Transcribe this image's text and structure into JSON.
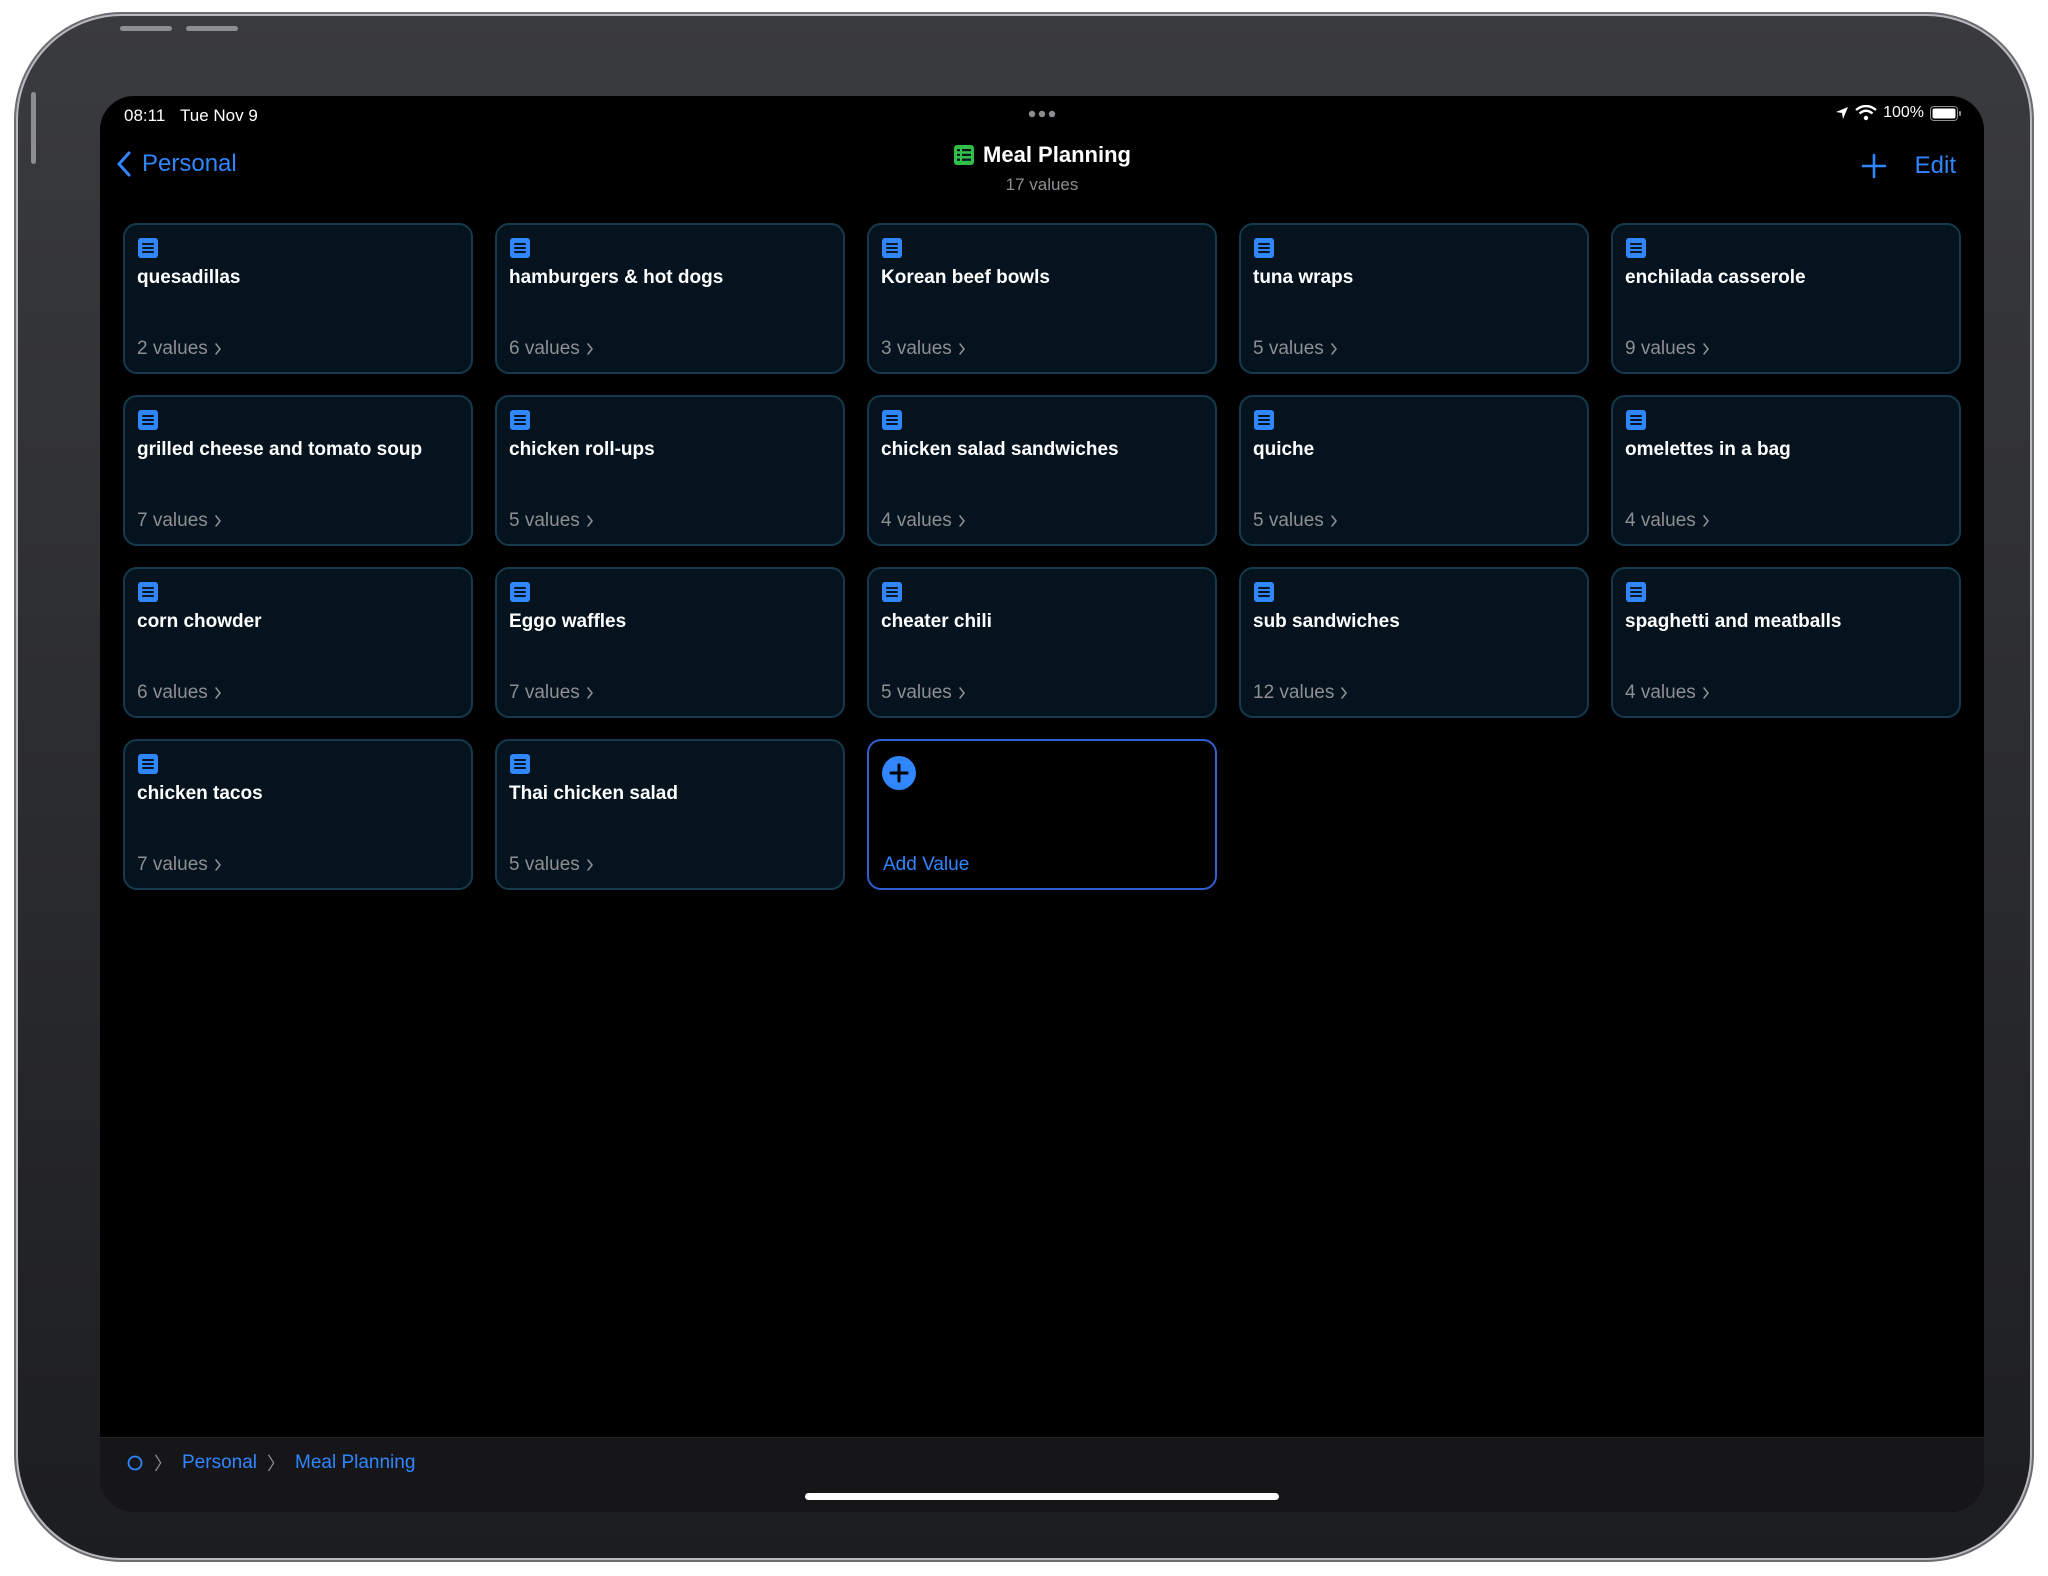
{
  "status": {
    "time": "08:11",
    "date": "Tue Nov 9",
    "battery": "100%"
  },
  "nav": {
    "back_label": "Personal",
    "title": "Meal Planning",
    "subtitle": "17 values",
    "edit_label": "Edit"
  },
  "cards": [
    {
      "title": "quesadillas",
      "count": "2 values"
    },
    {
      "title": "hamburgers & hot dogs",
      "count": "6 values"
    },
    {
      "title": "Korean beef bowls",
      "count": "3 values"
    },
    {
      "title": "tuna wraps",
      "count": "5 values"
    },
    {
      "title": "enchilada casserole",
      "count": "9 values"
    },
    {
      "title": "grilled cheese and tomato soup",
      "count": "7 values"
    },
    {
      "title": "chicken roll-ups",
      "count": "5 values"
    },
    {
      "title": "chicken salad sandwiches",
      "count": "4 values"
    },
    {
      "title": "quiche",
      "count": "5 values"
    },
    {
      "title": "omelettes in a bag",
      "count": "4 values"
    },
    {
      "title": "corn chowder",
      "count": "6 values"
    },
    {
      "title": "Eggo waffles",
      "count": "7 values"
    },
    {
      "title": "cheater chili",
      "count": "5 values"
    },
    {
      "title": "sub sandwiches",
      "count": "12 values"
    },
    {
      "title": "spaghetti and meatballs",
      "count": "4 values"
    },
    {
      "title": "chicken tacos",
      "count": "7 values"
    },
    {
      "title": "Thai chicken salad",
      "count": "5 values"
    }
  ],
  "add_card": {
    "label": "Add Value"
  },
  "breadcrumb": {
    "items": [
      "Personal",
      "Meal Planning"
    ]
  },
  "colors": {
    "accent": "#2f86ff",
    "card_border": "#15394d",
    "card_bg": "#04131d",
    "title_icon": "#30c048"
  },
  "icons": {
    "card_icon": "document-text-icon",
    "title_icon": "table-icon",
    "add_icon": "plus-circle-icon",
    "root_icon": "circle-icon"
  }
}
